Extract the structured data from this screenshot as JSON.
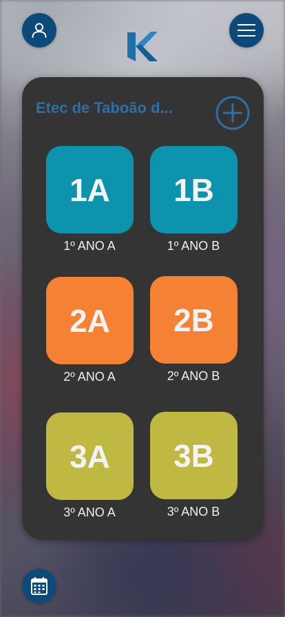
{
  "header": {
    "profile_icon": "user-icon",
    "menu_icon": "hamburger-menu-icon",
    "logo_icon": "k-logo-icon"
  },
  "card": {
    "title": "Etec de Taboão d...",
    "add_icon": "plus-circle-icon",
    "classes": [
      {
        "code": "1A",
        "label": "1º ANO A",
        "color": "#0d93ad"
      },
      {
        "code": "1B",
        "label": "1º ANO B",
        "color": "#0d93ad"
      },
      {
        "code": "2A",
        "label": "2º ANO A",
        "color": "#f58234"
      },
      {
        "code": "2B",
        "label": "2º ANO B",
        "color": "#f58234"
      },
      {
        "code": "3A",
        "label": "3º ANO A",
        "color": "#bfb843"
      },
      {
        "code": "3B",
        "label": "3º ANO B",
        "color": "#bfb843"
      }
    ]
  },
  "footer": {
    "calendar_icon": "calendar-icon"
  },
  "colors": {
    "accent": "#0d4a7a",
    "title": "#2f6fa3",
    "card_bg": "#343434"
  }
}
